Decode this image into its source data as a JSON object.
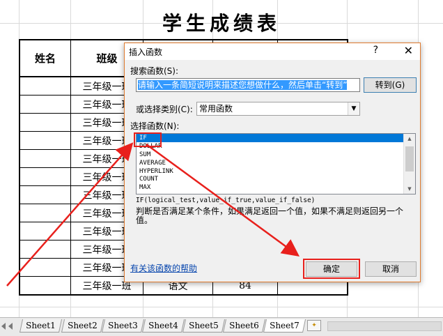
{
  "sheet": {
    "title": "学生成绩表",
    "headers": [
      "姓名",
      "班级",
      "",
      ""
    ],
    "rows": [
      [
        "",
        "三年级一班",
        "",
        ""
      ],
      [
        "",
        "三年级一班",
        "",
        ""
      ],
      [
        "",
        "三年级一班",
        "",
        ""
      ],
      [
        "",
        "三年级一班",
        "",
        ""
      ],
      [
        "",
        "三年级一班",
        "",
        ""
      ],
      [
        "",
        "三年级一班",
        "",
        ""
      ],
      [
        "",
        "三年级一班",
        "",
        ""
      ],
      [
        "",
        "三年级一班",
        "",
        ""
      ],
      [
        "",
        "三年级一班",
        "",
        ""
      ],
      [
        "",
        "三年级一班",
        "",
        ""
      ],
      [
        "",
        "三年级一班",
        "",
        ""
      ],
      [
        "",
        "三年级一班",
        "语文",
        "84"
      ]
    ]
  },
  "tabs": [
    "Sheet1",
    "Sheet2",
    "Sheet3",
    "Sheet4",
    "Sheet5",
    "Sheet6",
    "Sheet7"
  ],
  "active_tab": "Sheet7",
  "dialog": {
    "title": "插入函数",
    "help_glyph": "?",
    "close_glyph": "✕",
    "search_label": "搜索函数(S):",
    "search_value": "请输入一条简短说明来描述您想做什么，然后单击“转到”",
    "go_button": "转到(G)",
    "category_label": "或选择类别(C):",
    "category_value": "常用函数",
    "function_label": "选择函数(N):",
    "functions": [
      "IF",
      "DOLLAR",
      "SUM",
      "AVERAGE",
      "HYPERLINK",
      "COUNT",
      "MAX"
    ],
    "selected_function": "IF",
    "syntax": "IF(logical_test,value_if_true,value_if_false)",
    "description": "判断是否满足某个条件，如果满足返回一个值，如果不满足则返回另一个值。",
    "help_link": "有关该函数的帮助",
    "ok_button": "确定",
    "cancel_button": "取消"
  },
  "colors": {
    "annotation_red": "#e8201c",
    "selection_blue": "#0078d7",
    "dialog_border": "#e07b2f"
  }
}
